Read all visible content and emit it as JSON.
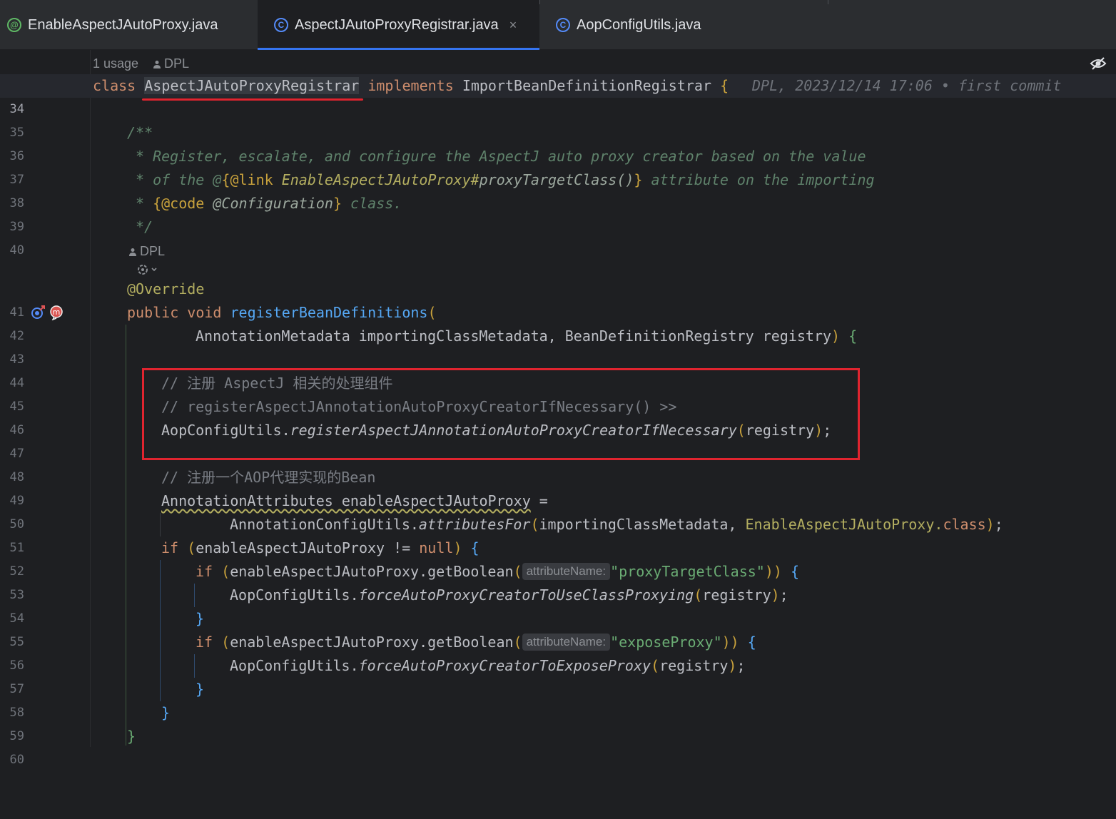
{
  "tabs": [
    {
      "label": "EnableAspectJAutoProxy.java",
      "icon": "annotation-icon",
      "icon_glyph": "@"
    },
    {
      "label": "AspectJAutoProxyRegistrar.java",
      "icon": "class-icon",
      "icon_glyph": "C",
      "close": "×"
    },
    {
      "label": "AopConfigUtils.java",
      "icon": "class-icon",
      "icon_glyph": "C"
    }
  ],
  "meta": {
    "usage": "1 usage",
    "author": "DPL",
    "method_author": "DPL"
  },
  "blame": "DPL, 2023/12/14 17:06 • first commit",
  "line_numbers": [
    "34",
    "35",
    "36",
    "37",
    "38",
    "39",
    "40",
    "41",
    "42",
    "43",
    "44",
    "45",
    "46",
    "47",
    "48",
    "49",
    "50",
    "51",
    "52",
    "53",
    "54",
    "55",
    "56",
    "57",
    "58",
    "59",
    "60"
  ],
  "code": {
    "l34": {
      "kw": "class",
      "name": "AspectJAutoProxyRegistrar",
      "impl": "implements",
      "iface": "ImportBeanDefinitionRegistrar",
      "brace": "{"
    },
    "l36": "/**",
    "l37": "* Register, escalate, and configure the AspectJ auto proxy creator based on the value",
    "l38": {
      "a": "* of the @",
      "b": "{@link",
      "c": "EnableAspectJAutoProxy#",
      "d": "proxyTargetClass",
      "e": "()",
      "f": "}",
      "g": " attribute on the importing"
    },
    "l39": {
      "a": "* ",
      "b": "{@code",
      "c": " @Configuration",
      "d": "}",
      "e": " class."
    },
    "l40": "*/",
    "l41": "@Override",
    "l42": {
      "kw1": "public",
      "kw2": "void",
      "fn": "registerBeanDefinitions",
      "paren": "("
    },
    "l43": {
      "a": "AnnotationMetadata importingClassMetadata, BeanDefinitionRegistry registry",
      "b": ")",
      "c": " {"
    },
    "l45": "// 注册 AspectJ 相关的处理组件",
    "l46": "// registerAspectJAnnotationAutoProxyCreatorIfNecessary() >>",
    "l47": {
      "a": "AopConfigUtils.",
      "b": "registerAspectJAnnotationAutoProxyCreatorIfNecessary",
      "c": "(",
      "d": "registry",
      "e": ")",
      "f": ";"
    },
    "l49": "// 注册一个AOP代理实现的Bean",
    "l50": {
      "a": "AnnotationAttributes enableAspectJAutoProxy",
      "b": " ="
    },
    "l51": {
      "a": "AnnotationConfigUtils.",
      "b": "attributesFor",
      "c": "(",
      "d": "importingClassMetadata, ",
      "e": "EnableAspectJAutoProxy",
      "f": ".",
      "g": "class",
      "h": ")",
      "i": ";"
    },
    "l52": {
      "kw": "if",
      "a": " (",
      "b": "enableAspectJAutoProxy != ",
      "c": "null",
      "d": ")",
      "e": " {"
    },
    "l53": {
      "kw": "if",
      "a": " (",
      "b": "enableAspectJAutoProxy.getBoolean",
      "c": "(",
      "hint": "attributeName:",
      "str": "\"proxyTargetClass\"",
      "d": "))",
      "e": " {"
    },
    "l54": {
      "a": "AopConfigUtils.",
      "b": "forceAutoProxyCreatorToUseClassProxying",
      "c": "(",
      "d": "registry",
      "e": ")",
      "f": ";"
    },
    "l55": "}",
    "l56": {
      "kw": "if",
      "a": " (",
      "b": "enableAspectJAutoProxy.getBoolean",
      "c": "(",
      "hint": "attributeName:",
      "str": "\"exposeProxy\"",
      "d": "))",
      "e": " {"
    },
    "l57": {
      "a": "AopConfigUtils.",
      "b": "forceAutoProxyCreatorToExposeProxy",
      "c": "(",
      "d": "registry",
      "e": ")",
      "f": ";"
    },
    "l58": "}",
    "l59": "}",
    "l60": "}"
  },
  "colors": {
    "background": "#1e1f22",
    "tab_active_underline": "#3574f0",
    "highlight_red": "#e0242f"
  }
}
